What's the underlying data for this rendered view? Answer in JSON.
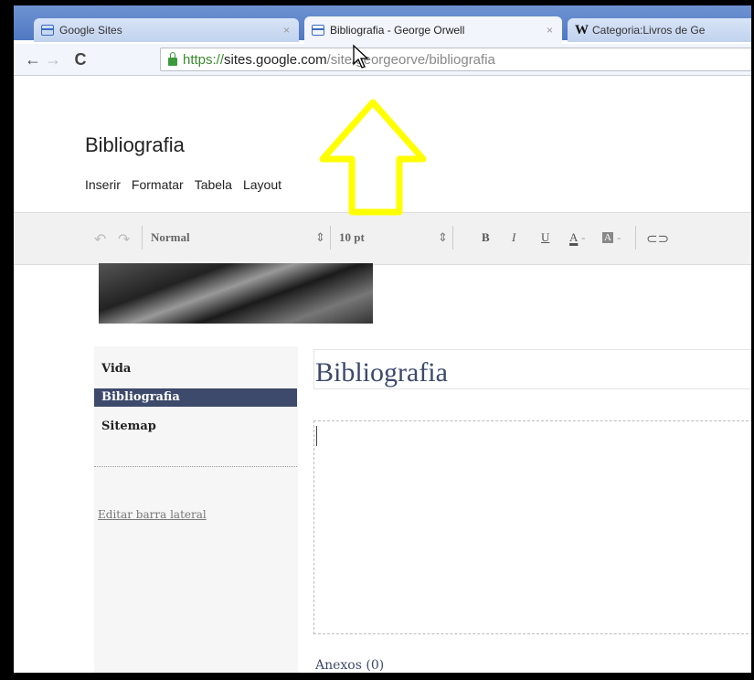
{
  "browser": {
    "tabs": [
      {
        "label": "Google Sites",
        "icon": "sites-icon",
        "active": false
      },
      {
        "label": "Bibliografia - George Orwell",
        "icon": "sites-icon",
        "active": true
      },
      {
        "label": "Categoria:Livros de Ge",
        "icon": "wikipedia-icon",
        "active": false
      }
    ],
    "close_glyph": "×",
    "url": {
      "scheme": "https://",
      "host": "sites.google.com",
      "path": "/site/georgeorve/bibliografia"
    }
  },
  "editor": {
    "site_title": "Bibliografia",
    "menu": [
      "Inserir",
      "Formatar",
      "Tabela",
      "Layout"
    ],
    "toolbar": {
      "style_value": "Normal",
      "size_value": "10 pt",
      "bold": "B",
      "italic": "I",
      "underline": "U",
      "font_color": "A",
      "highlight": "A"
    }
  },
  "sidebar": {
    "items": [
      {
        "label": "Vida",
        "selected": false
      },
      {
        "label": "Bibliografia",
        "selected": true
      },
      {
        "label": "Sitemap",
        "selected": false
      }
    ],
    "edit_link": "Editar barra lateral"
  },
  "page": {
    "heading": "Bibliografia",
    "attachments_label": "Anexos (0)"
  },
  "colors": {
    "tab_strip": "#5a82c8",
    "sidebar_selected": "#3d4a6b",
    "annotation_arrow": "#ffff00"
  }
}
